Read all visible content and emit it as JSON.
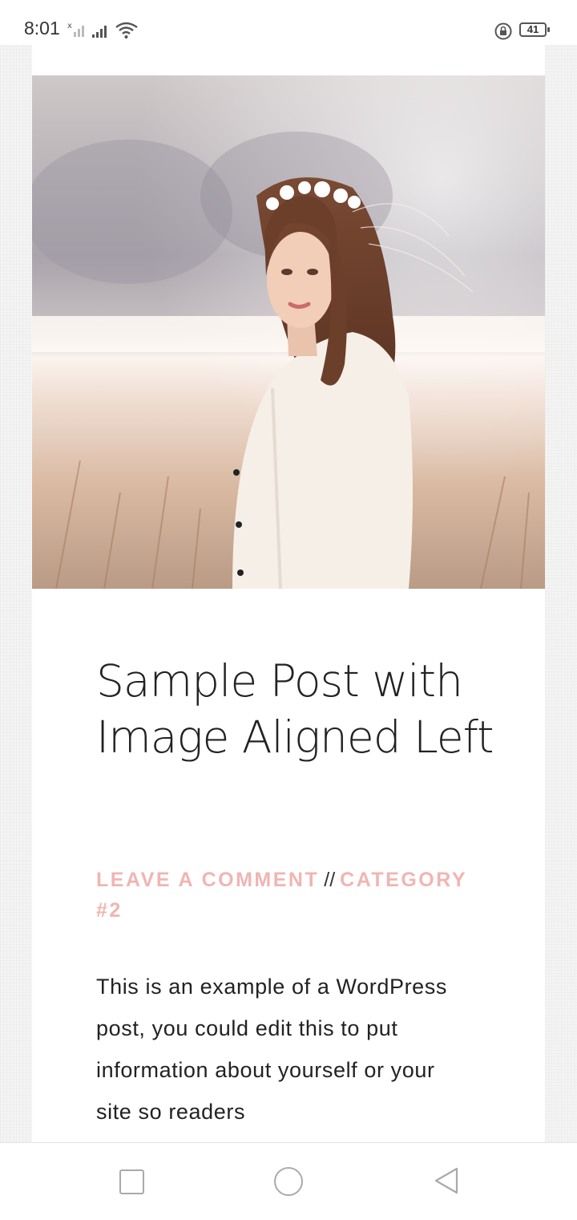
{
  "status_bar": {
    "time": "8:01",
    "battery_level": "41"
  },
  "post": {
    "title": "Sample Post with Image Aligned Left",
    "leave_comment_link": "LEAVE A COMMENT",
    "separator": "//",
    "category_link": "CATEGORY #2",
    "excerpt": "This is an example of a WordPress post, you could edit this to put information about yourself or your site so readers",
    "image_icon": "woman-in-field-photo"
  },
  "colors": {
    "accent_link": "#f0b5b2",
    "text": "#222222"
  },
  "nav": {
    "recents_icon": "square-icon",
    "home_icon": "circle-icon",
    "back_icon": "triangle-back-icon"
  }
}
